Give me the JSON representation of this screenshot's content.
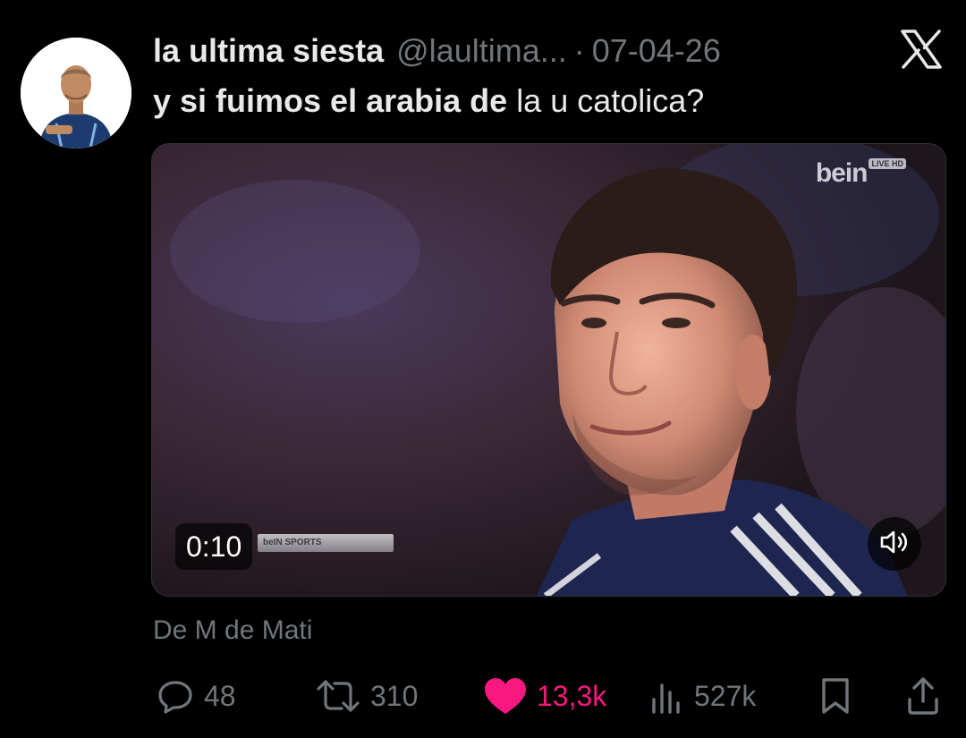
{
  "tweet": {
    "display_name": "la ultima siesta",
    "handle": "@laultima...",
    "separator": "·",
    "date": "07-04-26",
    "text_bold": "y si fuimos el arabia de",
    "text_regular": "la u catolica?",
    "source": "De M de Mati"
  },
  "media": {
    "timestamp": "0:10",
    "watermark": "bein",
    "watermark_badge": "LIVE HD",
    "ticker": "beIN SPORTS"
  },
  "actions": {
    "replies": "48",
    "reposts": "310",
    "likes": "13,3k",
    "views": "527k"
  },
  "icons": {
    "brand": "x-logo-icon",
    "reply": "reply-icon",
    "repost": "repost-icon",
    "like": "heart-icon",
    "views": "views-icon",
    "bookmark": "bookmark-icon",
    "share": "share-icon",
    "sound": "speaker-icon"
  },
  "colors": {
    "background": "#000000",
    "text": "#e7e9ea",
    "muted": "#71767b",
    "like": "#f91880"
  }
}
